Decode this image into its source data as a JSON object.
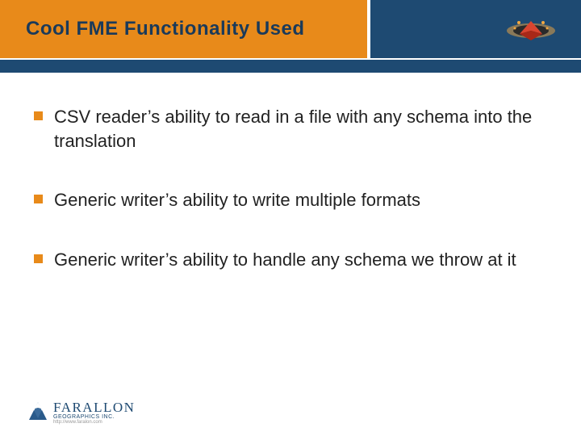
{
  "header": {
    "title": "Cool FME Functionality Used"
  },
  "bullets": [
    {
      "text": "CSV reader’s ability to read in a file with any schema into the translation"
    },
    {
      "text": "Generic writer’s ability to write multiple formats"
    },
    {
      "text": "Generic writer’s ability to handle any schema we throw at it"
    }
  ],
  "footer": {
    "company": "FARALLON",
    "subline": "GEOGRAPHICS INC.",
    "url": "http://www.faralon.com"
  },
  "colors": {
    "orange": "#e88a1a",
    "navy": "#1e4a72"
  }
}
